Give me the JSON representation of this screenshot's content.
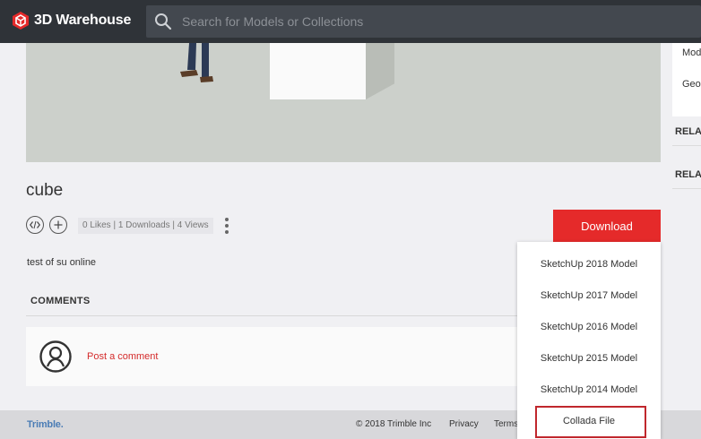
{
  "header": {
    "logo_text": "3D Warehouse",
    "search_placeholder": "Search for Models or Collections"
  },
  "right_panel": {
    "items": [
      "Mod",
      "Geo"
    ],
    "headings": [
      "RELAT",
      "RELAT"
    ]
  },
  "model": {
    "title": "cube",
    "stats": "0 Likes | 1 Downloads | 4 Views",
    "description": "test of su online",
    "download_label": "Download"
  },
  "download_menu": {
    "items": [
      "SketchUp 2018 Model",
      "SketchUp 2017 Model",
      "SketchUp 2016 Model",
      "SketchUp 2015 Model",
      "SketchUp 2014 Model",
      "Collada File"
    ]
  },
  "comments": {
    "heading": "COMMENTS",
    "post_link": "Post a comment"
  },
  "footer": {
    "brand": "Trimble.",
    "copyright": "© 2018 Trimble Inc",
    "privacy": "Privacy",
    "terms": "Terms"
  },
  "colors": {
    "header_bg": "#2f3338",
    "accent_red": "#e52a2a",
    "highlight_border": "#c0272d"
  }
}
